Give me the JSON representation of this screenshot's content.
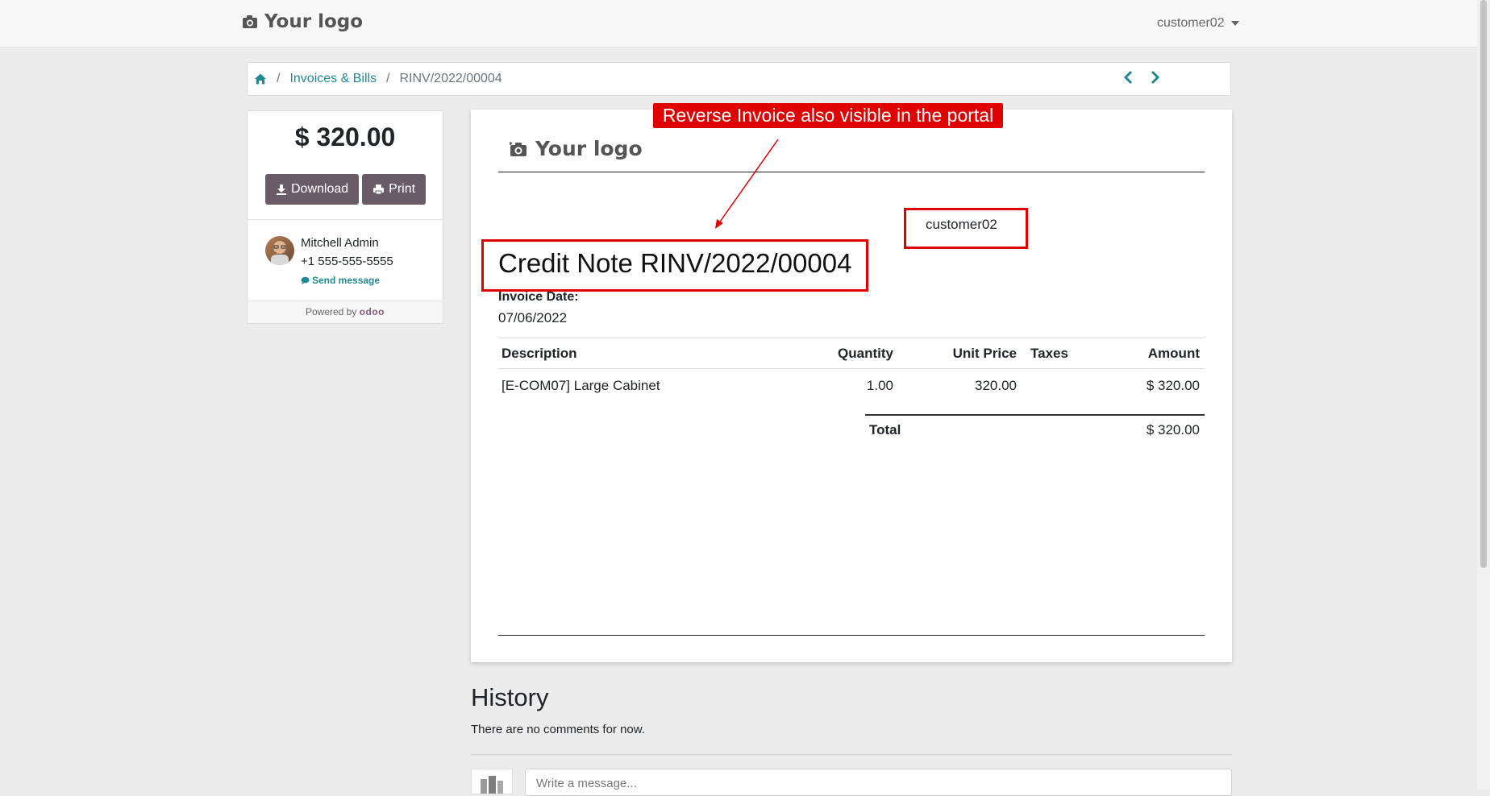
{
  "header": {
    "brand": "Your logo",
    "user": "customer02"
  },
  "breadcrumb": {
    "items": [
      "Invoices & Bills",
      "RINV/2022/00004"
    ]
  },
  "sidebar": {
    "amount": "$ 320.00",
    "download_label": "Download",
    "print_label": "Print",
    "contact_name": "Mitchell Admin",
    "contact_phone": "+1 555-555-5555",
    "send_message": "Send message",
    "powered_by": "Powered by",
    "powered_brand": "odoo"
  },
  "document": {
    "logo": "Your logo",
    "customer": "customer02",
    "title": "Credit Note RINV/2022/00004",
    "invoice_date_label": "Invoice Date:",
    "invoice_date": "07/06/2022",
    "columns": [
      "Description",
      "Quantity",
      "Unit Price",
      "Taxes",
      "Amount"
    ],
    "rows": [
      {
        "description": "[E-COM07] Large Cabinet",
        "quantity": "1.00",
        "unit_price": "320.00",
        "taxes": "",
        "amount": "$ 320.00"
      }
    ],
    "total_label": "Total",
    "total_amount": "$ 320.00"
  },
  "annotation": {
    "text": "Reverse Invoice also visible in the portal",
    "color": "#e10000"
  },
  "history": {
    "title": "History",
    "empty_text": "There are no comments for now.",
    "message_placeholder": "Write a message..."
  },
  "colors": {
    "accent": "#1f8a92",
    "button": "#6a5c66",
    "odoo": "#875a7b"
  }
}
